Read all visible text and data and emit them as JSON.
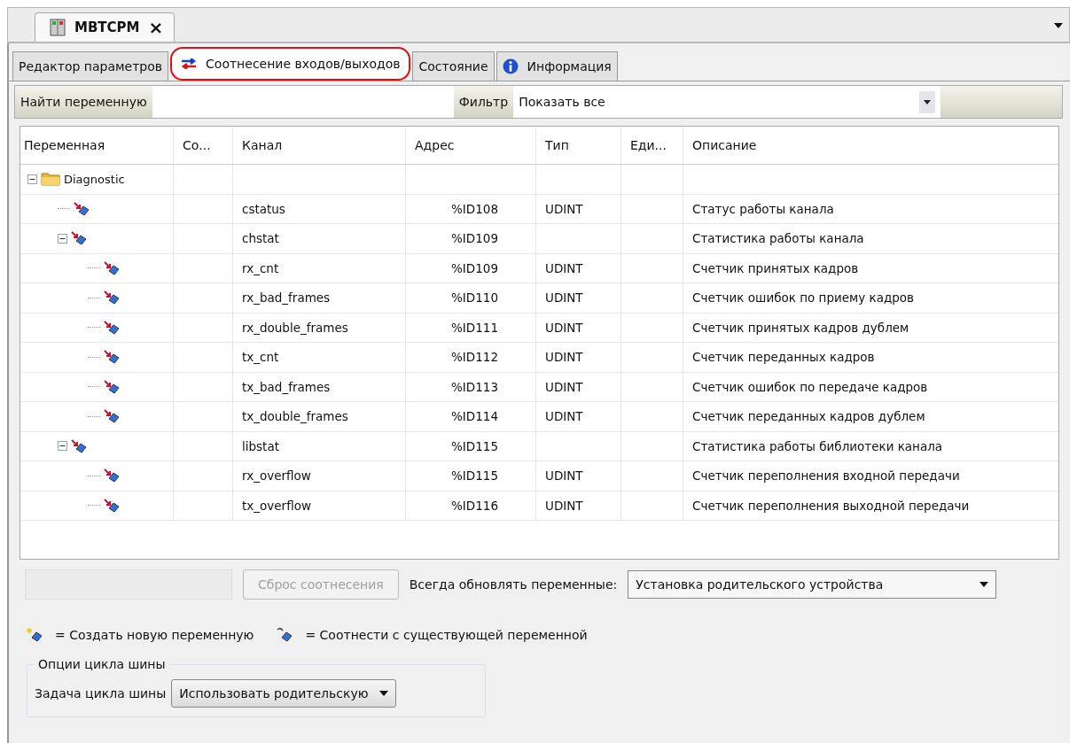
{
  "document_tab": {
    "title": "MBTCPM",
    "close": "×"
  },
  "tabs": [
    {
      "label": "Редактор параметров",
      "selected": false,
      "kind": "plain"
    },
    {
      "label": "Соотнесение входов/выходов",
      "selected": true,
      "kind": "mapping"
    },
    {
      "label": "Состояние",
      "selected": false,
      "kind": "plain"
    },
    {
      "label": "Информация",
      "selected": false,
      "kind": "info"
    }
  ],
  "find_bar": {
    "label": "Найти переменную",
    "filter_label": "Фильтр",
    "filter_value": "Показать все"
  },
  "table": {
    "columns": [
      "Переменная",
      "Со...",
      "Канал",
      "Адрес",
      "Тип",
      "Еди...",
      "Описание"
    ],
    "rows": [
      {
        "variable": "Diagnostic",
        "kind": "folder",
        "expanded": true,
        "children": [
          {
            "kind": "mapping",
            "channel": "cstatus",
            "address": "%ID108",
            "type": "UDINT",
            "description": "Статус работы канала"
          },
          {
            "kind": "mapping",
            "channel": "chstat",
            "address": "%ID109",
            "description": "Статистика работы канала",
            "expanded": true,
            "children": [
              {
                "kind": "mapping",
                "channel": "rx_cnt",
                "address": "%ID109",
                "type": "UDINT",
                "description": "Счетчик принятых кадров"
              },
              {
                "kind": "mapping",
                "channel": "rx_bad_frames",
                "address": "%ID110",
                "type": "UDINT",
                "description": "Счетчик ошибок по приему кадров"
              },
              {
                "kind": "mapping",
                "channel": "rx_double_frames",
                "address": "%ID111",
                "type": "UDINT",
                "description": "Счетчик принятых кадров дублем"
              },
              {
                "kind": "mapping",
                "channel": "tx_cnt",
                "address": "%ID112",
                "type": "UDINT",
                "description": "Счетчик переданных кадров"
              },
              {
                "kind": "mapping",
                "channel": "tx_bad_frames",
                "address": "%ID113",
                "type": "UDINT",
                "description": "Счетчик ошибок по передаче кадров"
              },
              {
                "kind": "mapping",
                "channel": "tx_double_frames",
                "address": "%ID114",
                "type": "UDINT",
                "description": "Счетчик переданных кадров дублем"
              }
            ]
          },
          {
            "kind": "mapping",
            "channel": "libstat",
            "address": "%ID115",
            "description": "Статистика работы библиотеки канала",
            "expanded": true,
            "children": [
              {
                "kind": "mapping",
                "channel": "rx_overflow",
                "address": "%ID115",
                "type": "UDINT",
                "description": "Счетчик переполнения входной передачи"
              },
              {
                "kind": "mapping",
                "channel": "tx_overflow",
                "address": "%ID116",
                "type": "UDINT",
                "description": "Счетчик переполнения выходной передачи"
              }
            ]
          }
        ]
      }
    ]
  },
  "controls": {
    "reset_button": {
      "label": "Сброс соотнесения",
      "disabled": true
    },
    "update_label": "Всегда обновлять переменные:",
    "update_value": "Установка родительского устройства"
  },
  "legend": {
    "new": "= Создать новую переменную",
    "existing": "= Соотнести с существующей переменной"
  },
  "bus_cycle": {
    "title": "Опции цикла шины",
    "label": "Задача цикла шины",
    "value": "Использовать родительскую"
  }
}
